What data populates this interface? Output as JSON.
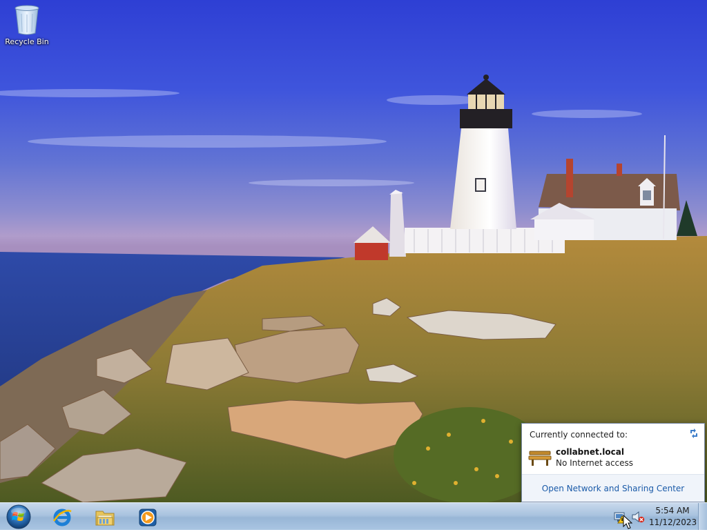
{
  "desktop": {
    "icons": [
      {
        "label": "Recycle Bin",
        "icon": "recycle-bin-icon"
      }
    ]
  },
  "network_flyout": {
    "heading": "Currently connected to:",
    "network_name": "collabnet.local",
    "network_status": "No Internet access",
    "footer_link": "Open Network and Sharing Center",
    "icons": [
      "refresh-icon",
      "network-bench-icon"
    ]
  },
  "taskbar": {
    "start_icon": "windows-start-icon",
    "pinned": [
      {
        "name": "Internet Explorer",
        "icon": "internet-explorer-icon"
      },
      {
        "name": "Windows Explorer",
        "icon": "folder-icon"
      },
      {
        "name": "Windows Media Player",
        "icon": "media-player-icon"
      }
    ],
    "tray": {
      "icons": [
        "network-warning-icon",
        "volume-muted-icon"
      ],
      "time": "5:54 AM",
      "date": "11/12/2023"
    }
  },
  "colors": {
    "link": "#1a5aa8",
    "taskbar": "#a9c3df",
    "sky": "#3f55dc"
  }
}
